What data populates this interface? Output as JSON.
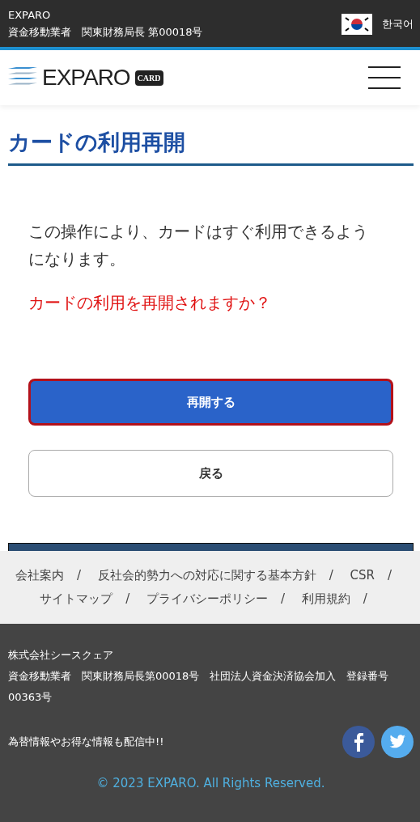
{
  "top_bar": {
    "company": "EXPARO",
    "license": "資金移動業者　関東財務局長 第00018号",
    "language": "한국어"
  },
  "header": {
    "logo_text": "EXPARO",
    "logo_badge": "CARD"
  },
  "page": {
    "title": "カードの利用再開",
    "message": "この操作により、カードはすぐ利用できるようになります。",
    "question": "カードの利用を再開されますか？"
  },
  "buttons": [
    {
      "label": "再開する",
      "kind": "primary",
      "focused": true
    },
    {
      "label": "戻る",
      "kind": "secondary",
      "focused": false
    }
  ],
  "footer_links": {
    "separator": "/",
    "items": [
      "会社案内",
      "反社会的勢力への対応に関する基本方針",
      "CSR",
      "サイトマップ",
      "プライバシーポリシー",
      "利用規約"
    ]
  },
  "footer": {
    "company": "株式会社シースクェア",
    "registration": "資金移動業者　関東財務局長第00018号　社団法人資金決済協会加入　登録番号00363号",
    "news": "為替情報やお得な情報も配信中!!",
    "copyright": "© 2023 EXPARO. All Rights Reserved."
  }
}
